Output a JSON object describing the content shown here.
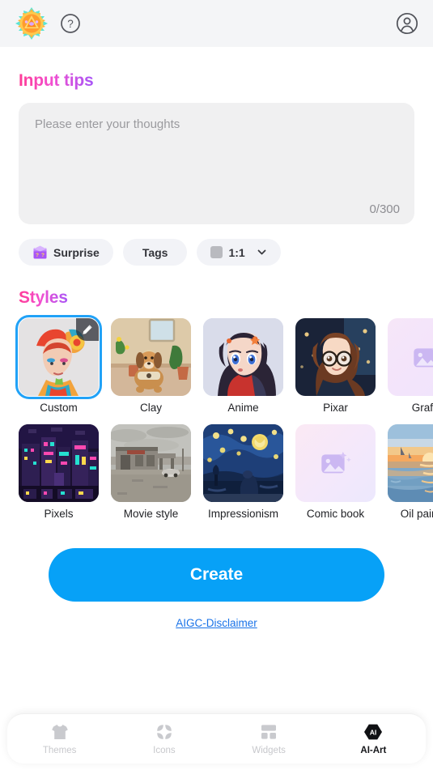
{
  "header": {
    "logo_icon": "mandala-logo-icon",
    "help_icon": "question-circle-icon",
    "avatar_icon": "account-circle-icon"
  },
  "input_section": {
    "title": "Input tips",
    "placeholder": "Please enter your thoughts",
    "value": "",
    "counter": "0/300",
    "max_length": 300
  },
  "chips": [
    {
      "label": "Surprise",
      "icon": "mystery-box-icon"
    },
    {
      "label": "Tags",
      "icon": ""
    },
    {
      "label": "1:1",
      "icon": "aspect-square-icon",
      "chevron": "chevron-down-icon"
    }
  ],
  "styles_section": {
    "title": "Styles",
    "selected": "Custom",
    "items": [
      {
        "label": "Custom",
        "selected": true,
        "badge_icon": "pencil-edit-icon",
        "kind": "photo"
      },
      {
        "label": "Clay",
        "selected": false,
        "kind": "photo"
      },
      {
        "label": "Anime",
        "selected": false,
        "kind": "photo"
      },
      {
        "label": "Pixar",
        "selected": false,
        "kind": "photo"
      },
      {
        "label": "Graffiti",
        "selected": false,
        "kind": "placeholder"
      },
      {
        "label": "Pixels",
        "selected": false,
        "kind": "photo"
      },
      {
        "label": "Movie style",
        "selected": false,
        "kind": "photo"
      },
      {
        "label": "Impressionism",
        "selected": false,
        "kind": "photo"
      },
      {
        "label": "Comic book",
        "selected": false,
        "kind": "placeholder"
      },
      {
        "label": "Oil painting",
        "selected": false,
        "kind": "photo"
      }
    ]
  },
  "actions": {
    "create_label": "Create",
    "disclaimer_label": "AIGC-Disclaimer"
  },
  "tabbar": {
    "active": "AI-Art",
    "items": [
      {
        "label": "Themes",
        "icon": "tshirt-icon",
        "active": false
      },
      {
        "label": "Icons",
        "icon": "grid-petals-icon",
        "active": false
      },
      {
        "label": "Widgets",
        "icon": "widgets-blocks-icon",
        "active": false
      },
      {
        "label": "AI-Art",
        "icon": "ai-hexagon-icon",
        "active": true
      }
    ]
  },
  "colors": {
    "accent_blue": "#07a1f7",
    "selection_blue": "#21a2f7",
    "gradient_start": "#ff3c96",
    "gradient_end": "#a855f7",
    "header_bg": "#f4f5f7",
    "field_bg": "#f0f0f1",
    "link_blue": "#1a73e8"
  }
}
